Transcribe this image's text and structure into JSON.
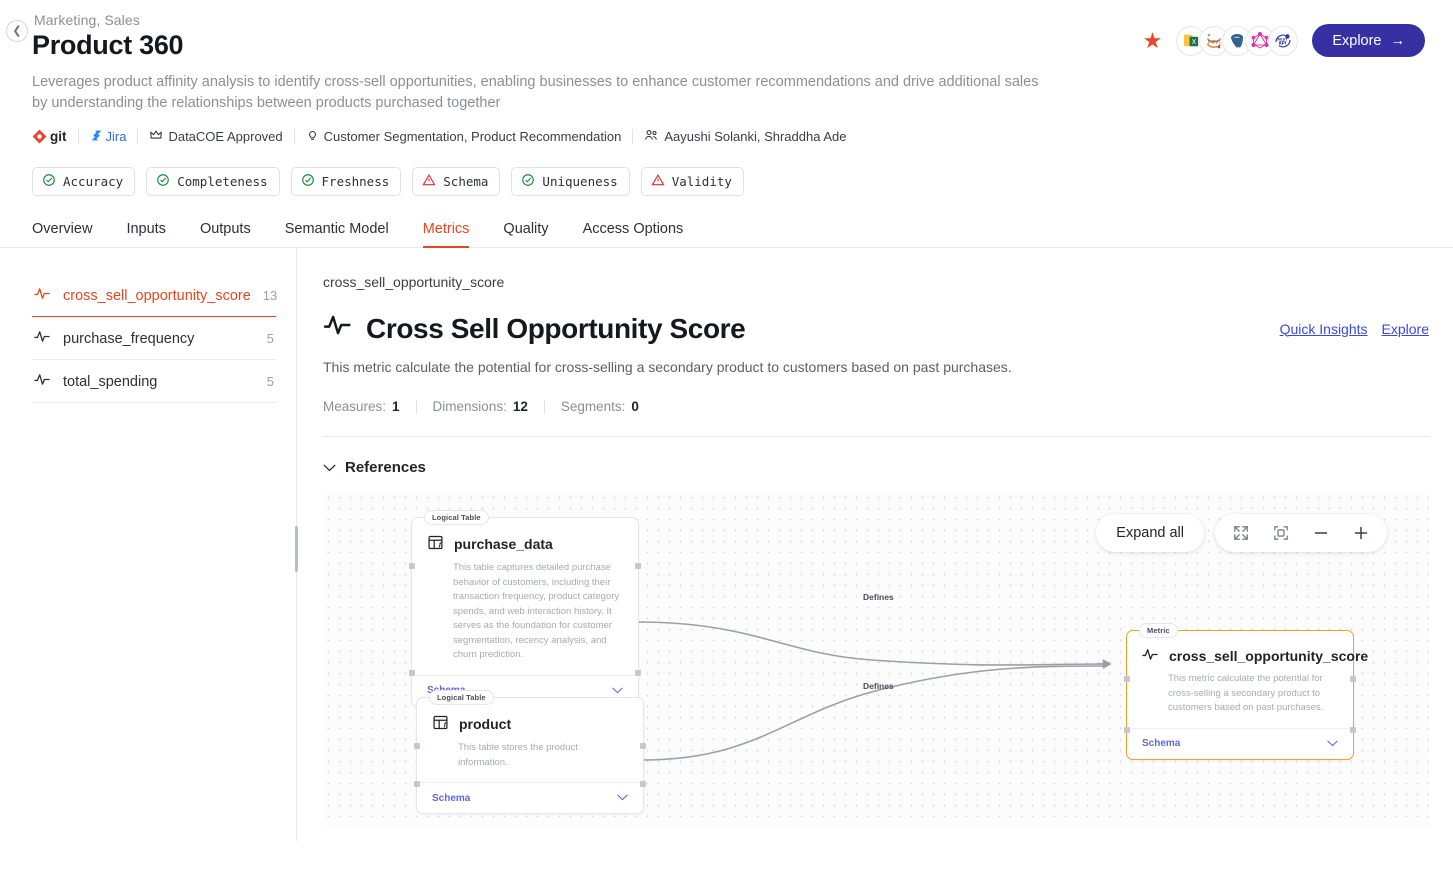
{
  "header": {
    "breadcrumb": "Marketing, Sales",
    "title": "Product 360",
    "description": "Leverages product affinity analysis to identify cross-sell opportunities, enabling businesses to enhance customer recommendations and drive additional sales by understanding the relationships between products purchased together",
    "back_icon": "chevron-left-icon",
    "star_icon": "star-icon",
    "explore_label": "Explore",
    "explore_arrow": "arrow-right-icon",
    "accent_color": "#e8461f",
    "explore_color": "#3730a3",
    "meta": [
      {
        "icon": "git-icon",
        "label": "git"
      },
      {
        "icon": "jira-icon",
        "label": "Jira"
      },
      {
        "icon": "crown-icon",
        "label": "DataCOE Approved"
      },
      {
        "icon": "bulb-icon",
        "label": "Customer Segmentation, Product Recommendation"
      },
      {
        "icon": "users-icon",
        "label": "Aayushi Solanki, Shraddha Ade"
      }
    ],
    "avatars": [
      {
        "name": "excel-icon",
        "title": "Excel"
      },
      {
        "name": "jupyter-icon",
        "title": "Jupyter"
      },
      {
        "name": "postgresql-icon",
        "title": "PostgreSQL"
      },
      {
        "name": "graphql-icon",
        "title": "GraphQL"
      },
      {
        "name": "rest-api-icon",
        "title": "REST API"
      }
    ],
    "badges": [
      {
        "label": "Accuracy",
        "status": "ok"
      },
      {
        "label": "Completeness",
        "status": "ok"
      },
      {
        "label": "Freshness",
        "status": "ok"
      },
      {
        "label": "Schema",
        "status": "warn"
      },
      {
        "label": "Uniqueness",
        "status": "ok"
      },
      {
        "label": "Validity",
        "status": "warn"
      }
    ]
  },
  "tabs": [
    {
      "label": "Overview",
      "active": false
    },
    {
      "label": "Inputs",
      "active": false
    },
    {
      "label": "Outputs",
      "active": false
    },
    {
      "label": "Semantic Model",
      "active": false
    },
    {
      "label": "Metrics",
      "active": true
    },
    {
      "label": "Quality",
      "active": false
    },
    {
      "label": "Access Options",
      "active": false
    }
  ],
  "sidebar": {
    "items": [
      {
        "label": "cross_sell_opportunity_score",
        "count": "13",
        "active": true
      },
      {
        "label": "purchase_frequency",
        "count": "5",
        "active": false
      },
      {
        "label": "total_spending",
        "count": "5",
        "active": false
      }
    ]
  },
  "main": {
    "subtitle": "cross_sell_opportunity_score",
    "title": "Cross Sell Opportunity Score",
    "title_icon": "activity-pulse-icon",
    "description": "This metric calculate the potential for cross-selling a secondary product to customers based on past purchases.",
    "links": [
      {
        "label": "Quick Insights"
      },
      {
        "label": "Explore"
      }
    ],
    "stats": [
      {
        "label": "Measures:",
        "value": "1"
      },
      {
        "label": "Dimensions:",
        "value": "12"
      },
      {
        "label": "Segments:",
        "value": "0"
      }
    ],
    "references_label": "References",
    "references_chevron": "chevron-down-icon"
  },
  "graph": {
    "toolbar": {
      "expand_all": "Expand all",
      "buttons": [
        {
          "name": "fullscreen-icon"
        },
        {
          "name": "fit-to-view-icon"
        },
        {
          "name": "zoom-out-icon"
        },
        {
          "name": "zoom-in-icon"
        }
      ]
    },
    "schema_label": "Schema",
    "schema_chevron": "chevron-down-icon",
    "nodes": [
      {
        "tag": "Logical Table",
        "title": "purchase_data",
        "icon": "table-function-icon",
        "desc": "This table captures detailed purchase behavior of customers, including their transaction frequency, product category spends, and web interaction history. It serves as the foundation for customer segmentation, recency analysis, and churn prediction.",
        "type": "table"
      },
      {
        "tag": "Logical Table",
        "title": "product",
        "icon": "table-function-icon",
        "desc": "This table stores the product information.",
        "type": "table"
      },
      {
        "tag": "Metric",
        "title": "cross_sell_opportunity_score",
        "icon": "activity-pulse-icon",
        "desc": "This metric calculate the potential for cross-selling a secondary product to customers based on past purchases.",
        "type": "metric"
      }
    ],
    "edges": [
      {
        "label": "Defines"
      },
      {
        "label": "Defines"
      }
    ]
  }
}
